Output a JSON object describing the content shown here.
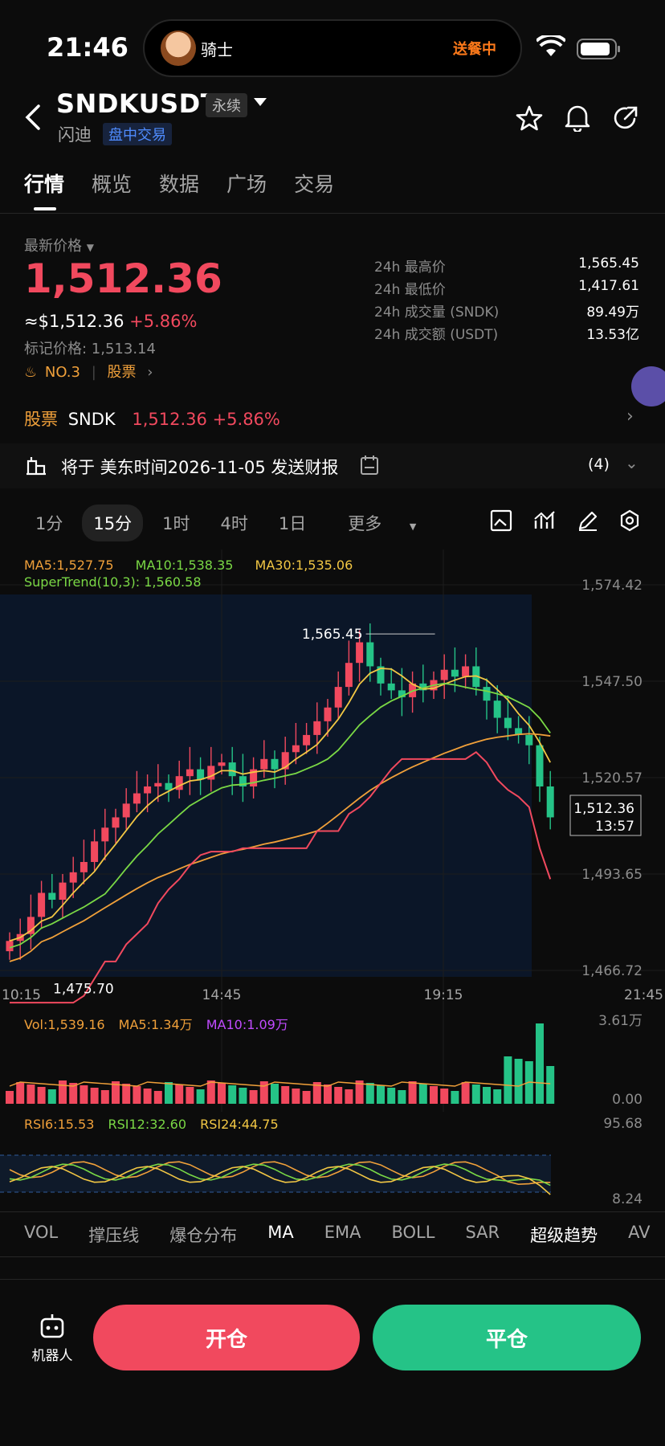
{
  "status": {
    "time": "21:46",
    "island_user": "骑士",
    "island_status": "送餐中"
  },
  "header": {
    "symbol": "SNDKUSDT",
    "contract_type": "永续",
    "name": "闪迪",
    "session": "盘中交易"
  },
  "tabs": [
    {
      "label": "行情",
      "active": true
    },
    {
      "label": "概览",
      "active": false
    },
    {
      "label": "数据",
      "active": false
    },
    {
      "label": "广场",
      "active": false
    },
    {
      "label": "交易",
      "active": false
    }
  ],
  "price": {
    "label": "最新价格",
    "last": "1,512.36",
    "usd": "≈$1,512.36",
    "change": "+5.86%",
    "mark_label": "标记价格: 1,513.14",
    "rank": "NO.3",
    "category": "股票"
  },
  "stats": [
    {
      "label": "24h 最高价",
      "value": "1,565.45"
    },
    {
      "label": "24h 最低价",
      "value": "1,417.61"
    },
    {
      "label": "24h 成交量 (SNDK)",
      "value": "89.49万"
    },
    {
      "label": "24h 成交额 (USDT)",
      "value": "13.53亿"
    }
  ],
  "stock_row": {
    "tag": "股票",
    "ticker": "SNDK",
    "price": "1,512.36",
    "change": "+5.86%"
  },
  "report": {
    "text": "将于 美东时间2026-11-05 发送财报",
    "count": "(4)"
  },
  "intervals": [
    {
      "label": "1分",
      "active": false
    },
    {
      "label": "15分",
      "active": true
    },
    {
      "label": "1时",
      "active": false
    },
    {
      "label": "4时",
      "active": false
    },
    {
      "label": "1日",
      "active": false
    },
    {
      "label": "更多",
      "active": false
    }
  ],
  "indicators": {
    "ma5": "MA5:1,527.75",
    "ma10": "MA10:1,538.35",
    "ma30": "MA30:1,535.06",
    "supertrend": "SuperTrend(10,3): 1,560.58",
    "vol": "Vol:1,539.16",
    "vol_ma5": "MA5:1.34万",
    "vol_ma10": "MA10:1.09万",
    "rsi6": "RSI6:15.53",
    "rsi12": "RSI12:32.60",
    "rsi24": "RSI24:44.75"
  },
  "chart_axis": {
    "price_ticks": [
      "1,574.42",
      "1,547.50",
      "1,520.57",
      "1,493.65",
      "1,466.72"
    ],
    "time_ticks": [
      "10:15",
      "14:45",
      "19:15",
      "21:45"
    ],
    "high_label": "1,565.45",
    "low_label": "1,475.70",
    "current_price": "1,512.36",
    "countdown": "13:57",
    "vol_ticks": [
      "3.61万",
      "0.00"
    ],
    "rsi_ticks": [
      "95.68",
      "8.24"
    ]
  },
  "indicator_tabs": [
    {
      "label": "VOL",
      "active": false
    },
    {
      "label": "撑压线",
      "active": false
    },
    {
      "label": "爆仓分布",
      "active": false
    },
    {
      "label": "MA",
      "active": true
    },
    {
      "label": "EMA",
      "active": false
    },
    {
      "label": "BOLL",
      "active": false
    },
    {
      "label": "SAR",
      "active": false
    },
    {
      "label": "超级趋势",
      "active": true
    },
    {
      "label": "AV",
      "active": false
    }
  ],
  "bottom": {
    "robot": "机器人",
    "open": "开仓",
    "close": "平仓"
  },
  "chart_data": {
    "type": "candlestick",
    "interval": "15分",
    "close": [
      1476,
      1478,
      1483,
      1490,
      1488,
      1493,
      1496,
      1499,
      1505,
      1509,
      1512,
      1516,
      1519,
      1521,
      1522,
      1520,
      1524,
      1526,
      1523,
      1527,
      1528,
      1524,
      1521,
      1526,
      1529,
      1526,
      1531,
      1533,
      1536,
      1540,
      1544,
      1550,
      1557,
      1563,
      1556,
      1551,
      1549,
      1547,
      1551,
      1549,
      1552,
      1555,
      1553,
      1556,
      1550,
      1546,
      1541,
      1538,
      1536,
      1533,
      1521,
      1512
    ],
    "colors": {
      "up": "#f1495e",
      "down": "#25c387",
      "ma5": "#f2c744",
      "ma10": "#7ad845",
      "ma30": "#f0a03a",
      "supertrend": "#f1495e"
    }
  }
}
